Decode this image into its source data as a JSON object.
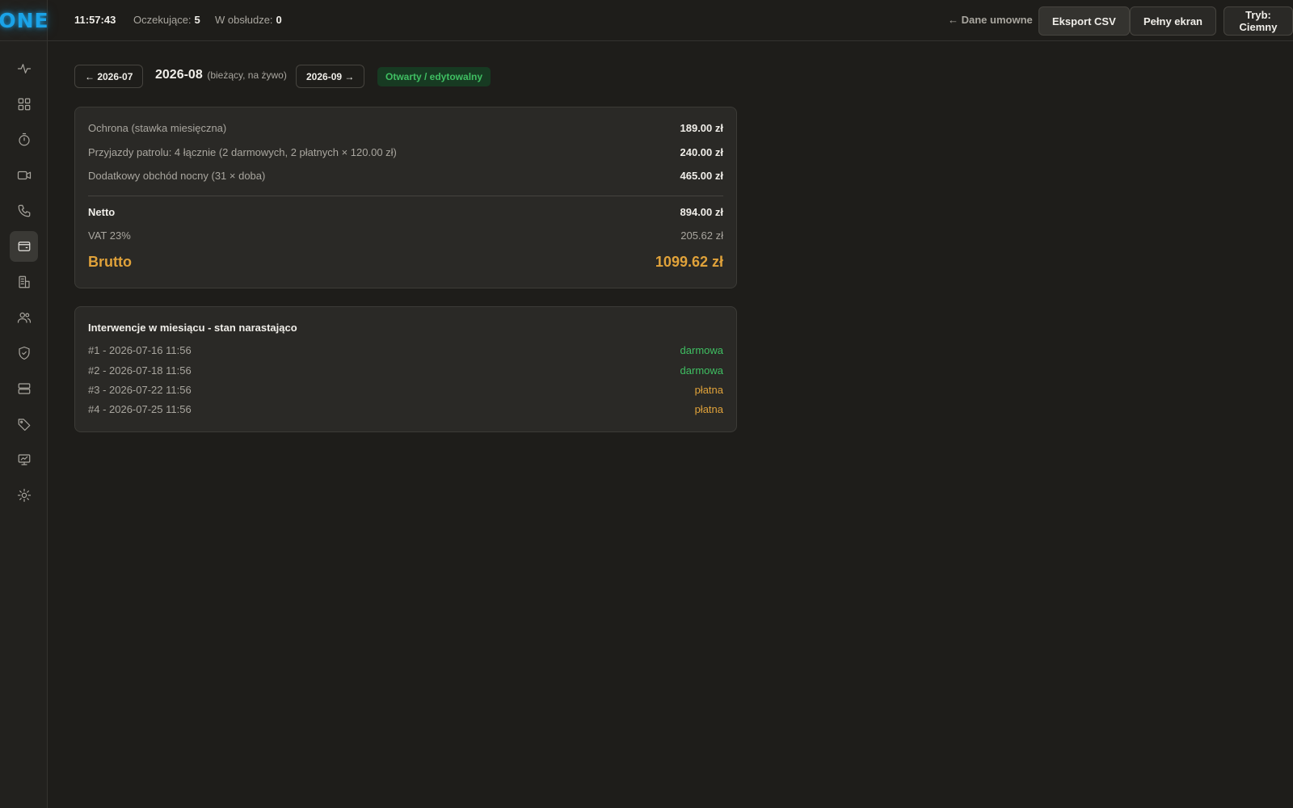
{
  "app": {
    "logo": "ONE"
  },
  "sidebar": {
    "items": [
      {
        "icon": "activity-icon"
      },
      {
        "icon": "dashboard-grid-icon"
      },
      {
        "icon": "timer-icon"
      },
      {
        "icon": "video-camera-icon"
      },
      {
        "icon": "phone-icon"
      },
      {
        "icon": "wallet-icon",
        "active": true
      },
      {
        "icon": "building-icon"
      },
      {
        "icon": "users-icon"
      },
      {
        "icon": "shield-check-icon"
      },
      {
        "icon": "server-icon"
      },
      {
        "icon": "tag-icon"
      },
      {
        "icon": "monitor-icon"
      },
      {
        "icon": "sun-icon"
      }
    ]
  },
  "topbar": {
    "clock": "11:57:43",
    "pending_label": "Oczekujące:",
    "pending_value": "5",
    "in_service_label": "W obsłudze:",
    "in_service_value": "0",
    "back_link": "← Dane umowne",
    "export_button": "Eksport CSV",
    "fullscreen_button": "Pełny ekran",
    "theme_button": "Tryb: Ciemny"
  },
  "period": {
    "prev_button": "← 2026-07",
    "current_month": "2026-08",
    "current_sub": "(bieżący, na żywo)",
    "next_button": "2026-09 →",
    "status": "Otwarty / edytowalny"
  },
  "summary": {
    "lines": [
      {
        "label": "Ochrona (stawka miesięczna)",
        "value": "189.00 zł"
      },
      {
        "label": "Przyjazdy patrolu: 4 łącznie (2 darmowych, 2 płatnych × 120.00 zł)",
        "value": "240.00 zł"
      },
      {
        "label": "Dodatkowy obchód nocny (31 × doba)",
        "value": "465.00 zł"
      }
    ],
    "netto_label": "Netto",
    "netto_value": "894.00 zł",
    "vat_label": "VAT 23%",
    "vat_value": "205.62 zł",
    "brutto_label": "Brutto",
    "brutto_value": "1099.62 zł"
  },
  "interventions": {
    "title": "Interwencje w miesiącu - stan narastająco",
    "rows": [
      {
        "label": "#1 - 2026-07-16 11:56",
        "status": "darmowa"
      },
      {
        "label": "#2 - 2026-07-18 11:56",
        "status": "darmowa"
      },
      {
        "label": "#3 - 2026-07-22 11:56",
        "status": "płatna"
      },
      {
        "label": "#4 - 2026-07-25 11:56",
        "status": "płatna"
      }
    ]
  },
  "colors": {
    "accent_logo": "#1aa3e8",
    "free": "#3fbf62",
    "paid": "#e0a23a",
    "background": "#1e1d1a"
  }
}
